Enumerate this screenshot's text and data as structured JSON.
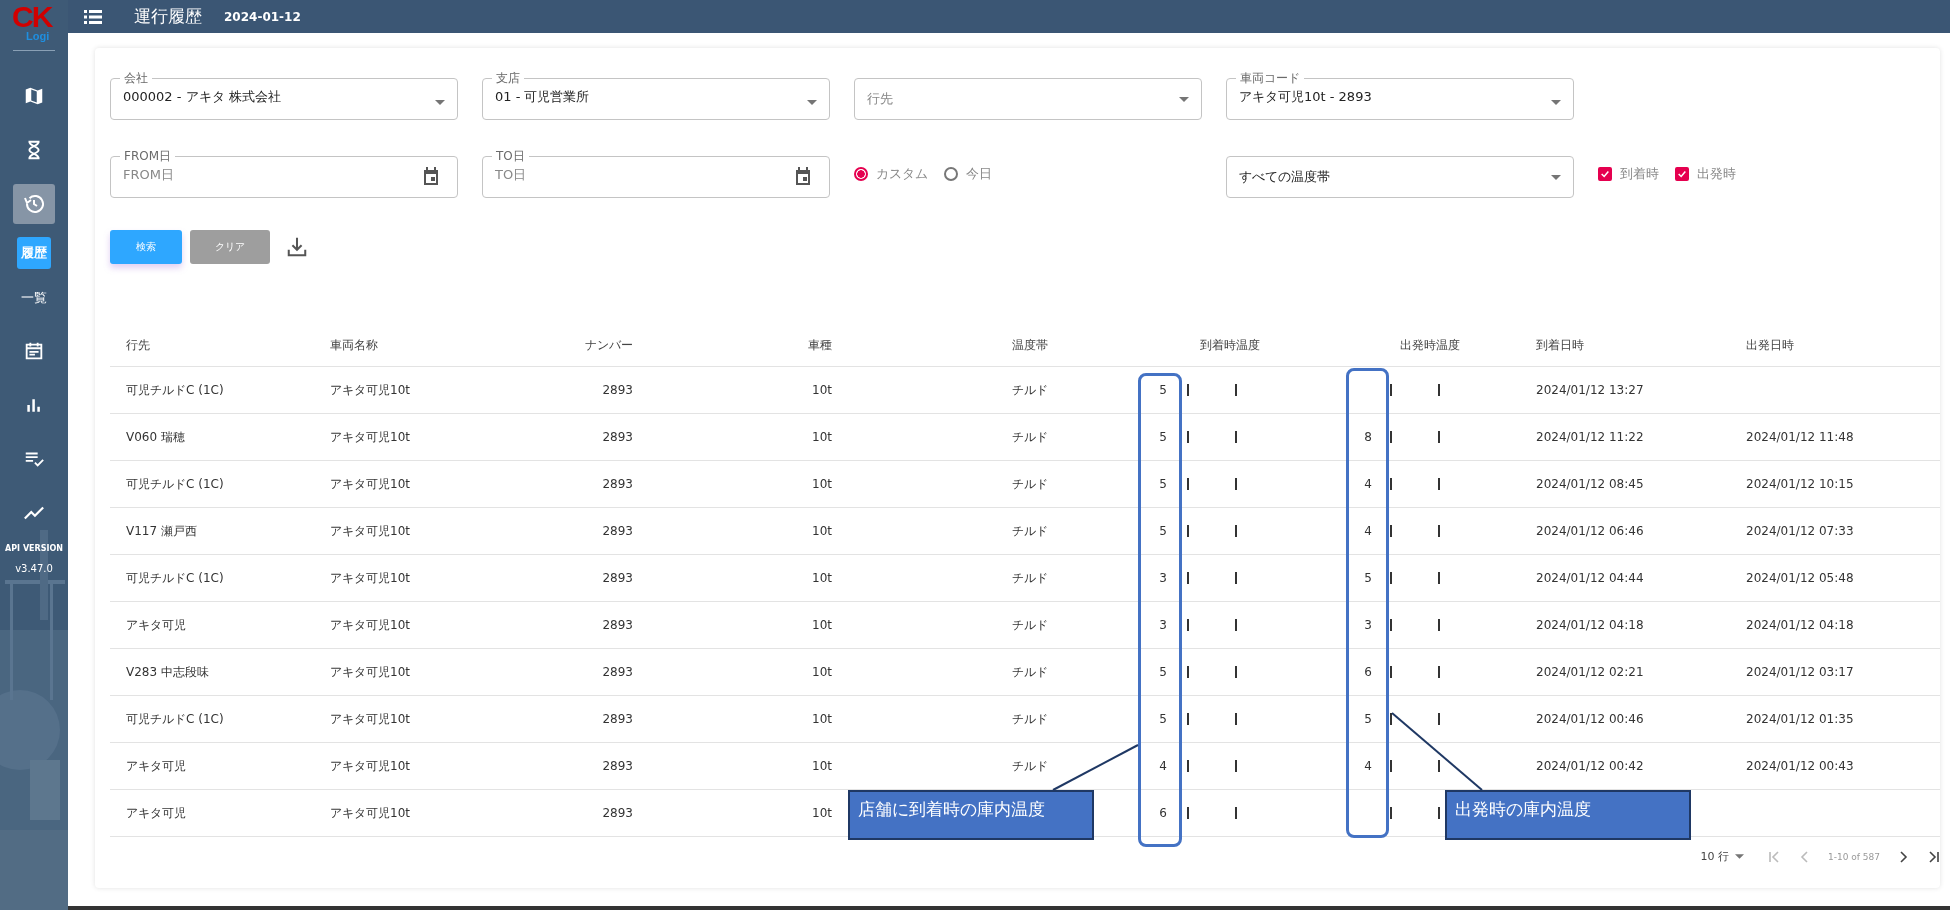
{
  "logo": {
    "main": "CK",
    "sub": "Logi"
  },
  "sidebar": {
    "items": [
      {
        "kind": "icon",
        "selected": false
      },
      {
        "kind": "icon",
        "selected": false
      },
      {
        "kind": "icon",
        "selected": true
      },
      {
        "kind": "label",
        "label": "履歴",
        "selected": true
      },
      {
        "kind": "label",
        "label": "一覧",
        "selected": false
      },
      {
        "kind": "icon",
        "selected": false
      },
      {
        "kind": "icon",
        "selected": false
      },
      {
        "kind": "icon",
        "selected": false
      },
      {
        "kind": "icon",
        "selected": false
      }
    ],
    "api_label": "API VERSION",
    "version": "v3.47.0"
  },
  "header": {
    "title": "運行履歴",
    "date": "2024-01-12"
  },
  "filters": {
    "row1": [
      {
        "kind": "select",
        "label": "会社",
        "value": "000002 - アキタ 株式会社"
      },
      {
        "kind": "select",
        "label": "支店",
        "value": "01 - 可児営業所"
      },
      {
        "kind": "select",
        "placeholder": "行先"
      },
      {
        "kind": "select",
        "label": "車両コード",
        "value": "アキタ可児10t - 2893"
      }
    ],
    "row2": [
      {
        "kind": "date",
        "label": "FROM日",
        "placeholder": "FROM日"
      },
      {
        "kind": "date",
        "label": "TO日",
        "placeholder": "TO日"
      }
    ],
    "radios": [
      {
        "label": "カスタム",
        "selected": true
      },
      {
        "label": "今日",
        "selected": false
      }
    ],
    "temperature_zone": {
      "value": "すべての温度帯"
    },
    "checkboxes": [
      {
        "label": "到着時",
        "checked": true
      },
      {
        "label": "出発時",
        "checked": true
      }
    ]
  },
  "buttons": [
    {
      "kind": "primary",
      "label": "検索"
    },
    {
      "kind": "secondary",
      "label": "クリア"
    }
  ],
  "table": {
    "columns": [
      "行先",
      "車両名称",
      "ナンバー",
      "車種",
      "温度帯",
      "到着時温度",
      "出発時温度",
      "到着日時",
      "出発日時"
    ],
    "rows": [
      {
        "destination": "可児チルドC (1C)",
        "vehicle": "アキタ可児10t",
        "number": "2893",
        "type": "10t",
        "zone": "チルド",
        "arrival_temp": "5",
        "arrival_time": "2024/01/12 13:27"
      },
      {
        "destination": "V060 瑞穂",
        "vehicle": "アキタ可児10t",
        "number": "2893",
        "type": "10t",
        "zone": "チルド",
        "arrival_temp": "5",
        "departure_temp": "8",
        "arrival_time": "2024/01/12 11:22",
        "departure_time": "2024/01/12 11:48"
      },
      {
        "destination": "可児チルドC (1C)",
        "vehicle": "アキタ可児10t",
        "number": "2893",
        "type": "10t",
        "zone": "チルド",
        "arrival_temp": "5",
        "departure_temp": "4",
        "arrival_time": "2024/01/12 08:45",
        "departure_time": "2024/01/12 10:15"
      },
      {
        "destination": "V117 瀬戸西",
        "vehicle": "アキタ可児10t",
        "number": "2893",
        "type": "10t",
        "zone": "チルド",
        "arrival_temp": "5",
        "departure_temp": "4",
        "arrival_time": "2024/01/12 06:46",
        "departure_time": "2024/01/12 07:33"
      },
      {
        "destination": "可児チルドC (1C)",
        "vehicle": "アキタ可児10t",
        "number": "2893",
        "type": "10t",
        "zone": "チルド",
        "arrival_temp": "3",
        "departure_temp": "5",
        "arrival_time": "2024/01/12 04:44",
        "departure_time": "2024/01/12 05:48"
      },
      {
        "destination": "アキタ可児",
        "vehicle": "アキタ可児10t",
        "number": "2893",
        "type": "10t",
        "zone": "チルド",
        "arrival_temp": "3",
        "departure_temp": "3",
        "arrival_time": "2024/01/12 04:18",
        "departure_time": "2024/01/12 04:18"
      },
      {
        "destination": "V283 中志段味",
        "vehicle": "アキタ可児10t",
        "number": "2893",
        "type": "10t",
        "zone": "チルド",
        "arrival_temp": "5",
        "departure_temp": "6",
        "arrival_time": "2024/01/12 02:21",
        "departure_time": "2024/01/12 03:17"
      },
      {
        "destination": "可児チルドC (1C)",
        "vehicle": "アキタ可児10t",
        "number": "2893",
        "type": "10t",
        "zone": "チルド",
        "arrival_temp": "5",
        "departure_temp": "5",
        "arrival_time": "2024/01/12 00:46",
        "departure_time": "2024/01/12 01:35"
      },
      {
        "destination": "アキタ可児",
        "vehicle": "アキタ可児10t",
        "number": "2893",
        "type": "10t",
        "zone": "チルド",
        "arrival_temp": "4",
        "departure_temp": "4",
        "arrival_time": "2024/01/12 00:42",
        "departure_time": "2024/01/12 00:43"
      },
      {
        "destination": "アキタ可児",
        "vehicle": "アキタ可児10t",
        "number": "2893",
        "type": "10t",
        "arrival_temp": "6"
      }
    ]
  },
  "pagination": {
    "rows_per_page": "10 行",
    "range": "1-10 of 587",
    "nav": [
      {
        "disabled": true
      },
      {
        "disabled": true
      },
      {
        "disabled": false
      },
      {
        "disabled": false
      }
    ]
  },
  "annotations": [
    {
      "text": "店舗に到着時の庫内温度"
    },
    {
      "text": "出発時の庫内温度"
    }
  ]
}
